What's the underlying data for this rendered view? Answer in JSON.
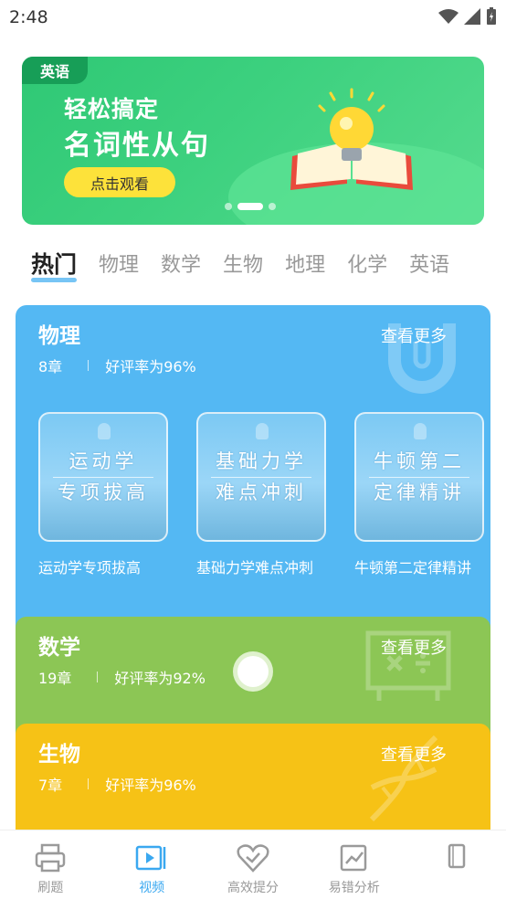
{
  "status_bar": {
    "time": "2:48"
  },
  "banner": {
    "tag": "英语",
    "title_line1": "轻松搞定",
    "title_line2": "名词性从句",
    "button_label": "点击观看"
  },
  "tabs": [
    {
      "label": "热门",
      "active": true
    },
    {
      "label": "物理"
    },
    {
      "label": "数学"
    },
    {
      "label": "生物"
    },
    {
      "label": "地理"
    },
    {
      "label": "化学"
    },
    {
      "label": "英语"
    }
  ],
  "cards": {
    "physics": {
      "title": "物理",
      "more": "查看更多",
      "chapters": "8章",
      "rating": "好评率为96%",
      "courses": [
        {
          "thumb_line1": "运动学",
          "thumb_line2": "专项拔高",
          "name": "运动学专项拔高"
        },
        {
          "thumb_line1": "基础力学",
          "thumb_line2": "难点冲刺",
          "name": "基础力学难点冲刺"
        },
        {
          "thumb_line1": "牛顿第二",
          "thumb_line2": "定律精讲",
          "name": "牛顿第二定律精讲"
        }
      ]
    },
    "math": {
      "title": "数学",
      "more": "查看更多",
      "chapters": "19章",
      "rating": "好评率为92%"
    },
    "biology": {
      "title": "生物",
      "more": "查看更多",
      "chapters": "7章",
      "rating": "好评率为96%"
    }
  },
  "bottom_nav": [
    {
      "label": "刷题",
      "icon": "printer-icon"
    },
    {
      "label": "视频",
      "icon": "video-icon",
      "active": true
    },
    {
      "label": "高效提分",
      "icon": "heart-check-icon"
    },
    {
      "label": "易错分析",
      "icon": "chart-icon"
    },
    {
      "label": "",
      "icon": "notebook-icon"
    }
  ],
  "colors": {
    "physics": "#54b8f3",
    "math": "#8cc655",
    "biology": "#f6c216",
    "banner": "#3dd17f",
    "accent": "#3aa8f0"
  }
}
